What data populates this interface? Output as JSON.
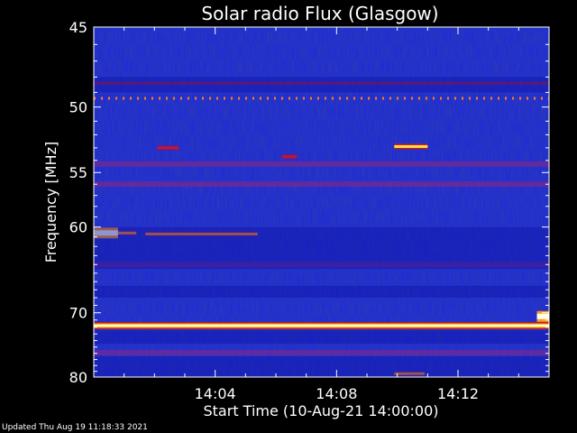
{
  "chart_data": {
    "type": "heatmap",
    "title": "Solar radio Flux (Glasgow)",
    "xlabel": "Start Time (10-Aug-21 14:00:00)",
    "ylabel": "Frequency [MHz]",
    "x_unit": "minutes after 14:00",
    "xlim": [
      0,
      15
    ],
    "ylim": [
      45,
      80
    ],
    "y_scale": "reciprocal",
    "x_ticks": [
      {
        "value": 4,
        "label": "14:04"
      },
      {
        "value": 8,
        "label": "14:08"
      },
      {
        "value": 12,
        "label": "14:12"
      }
    ],
    "y_ticks": [
      {
        "value": 45,
        "label": "45"
      },
      {
        "value": 50,
        "label": "50"
      },
      {
        "value": 55,
        "label": "55"
      },
      {
        "value": 60,
        "label": "60"
      },
      {
        "value": 70,
        "label": "70"
      },
      {
        "value": 80,
        "label": "80"
      }
    ],
    "y_minor_ticks": [
      46,
      47,
      48,
      49,
      51,
      52,
      53,
      54,
      56,
      57,
      58,
      59,
      61,
      62,
      63,
      64,
      65,
      66,
      67,
      68,
      69,
      71,
      72,
      73,
      74,
      75,
      76,
      77,
      78,
      79
    ],
    "colormap": [
      "#0a0a6e",
      "#1420d8",
      "#2a3cff",
      "#6a1aa0",
      "#c01818",
      "#ff7a00",
      "#ffff80",
      "#ffffff"
    ],
    "background_color": "#1a26e0",
    "persistent_bands": [
      {
        "freq_mhz": 48.4,
        "intensity": "red"
      },
      {
        "freq_mhz": 49.4,
        "intensity": "orange-dotted"
      },
      {
        "freq_mhz": 54.3,
        "intensity": "purple"
      },
      {
        "freq_mhz": 56.0,
        "intensity": "purple"
      },
      {
        "freq_mhz": 64.0,
        "intensity": "purple"
      },
      {
        "freq_mhz": 71.8,
        "intensity": "white-hot"
      },
      {
        "freq_mhz": 75.9,
        "intensity": "purple"
      }
    ],
    "bursts": [
      {
        "t_start": 0.0,
        "t_end": 0.8,
        "freq_mhz": 60.6,
        "intensity": "white-hot"
      },
      {
        "t_start": 0.8,
        "t_end": 1.4,
        "freq_mhz": 60.6,
        "intensity": "orange"
      },
      {
        "t_start": 1.7,
        "t_end": 5.4,
        "freq_mhz": 60.7,
        "intensity": "orange"
      },
      {
        "t_start": 2.1,
        "t_end": 2.8,
        "freq_mhz": 53.0,
        "intensity": "red"
      },
      {
        "t_start": 6.2,
        "t_end": 6.7,
        "freq_mhz": 53.7,
        "intensity": "red"
      },
      {
        "t_start": 9.9,
        "t_end": 11.0,
        "freq_mhz": 52.9,
        "intensity": "yellow"
      },
      {
        "t_start": 9.9,
        "t_end": 10.9,
        "freq_mhz": 79.4,
        "intensity": "orange"
      },
      {
        "t_start": 14.6,
        "t_end": 15.0,
        "freq_mhz": 70.5,
        "intensity": "white-hot"
      }
    ]
  },
  "footer": {
    "updated": "Updated Thu Aug 19 11:18:33 2021"
  }
}
